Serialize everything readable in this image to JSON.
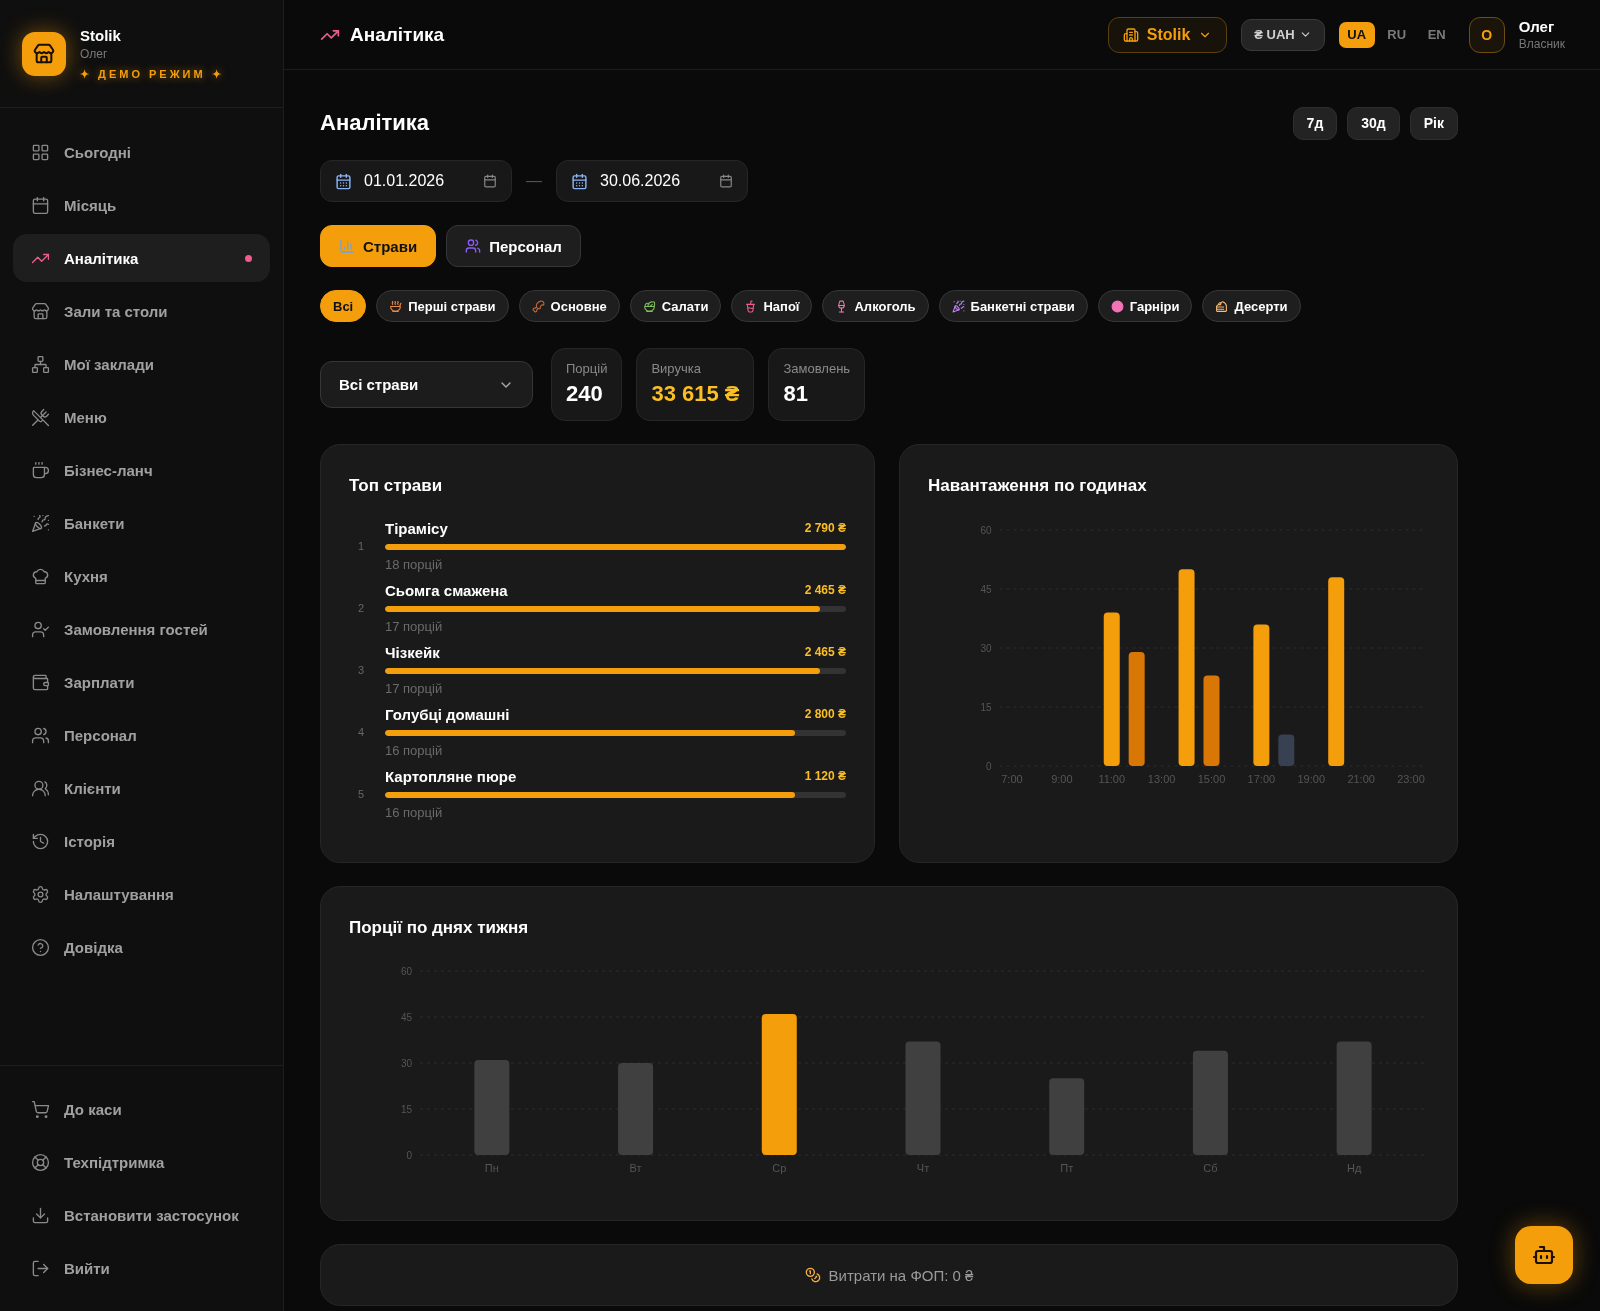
{
  "sidebar": {
    "brand": {
      "name": "Stolik",
      "user": "Олег",
      "mode_badge": "✦ ДЕМО РЕЖИМ ✦"
    },
    "nav": [
      {
        "label": "Сьогодні",
        "selected": false
      },
      {
        "label": "Місяць",
        "selected": false
      },
      {
        "label": "Аналітика",
        "selected": true
      },
      {
        "label": "Зали та столи",
        "selected": false
      },
      {
        "label": "Мої заклади",
        "selected": false
      },
      {
        "label": "Меню",
        "selected": false
      },
      {
        "label": "Бізнес-ланч",
        "selected": false
      },
      {
        "label": "Банкети",
        "selected": false
      },
      {
        "label": "Кухня",
        "selected": false
      },
      {
        "label": "Замовлення гостей",
        "selected": false
      },
      {
        "label": "Зарплати",
        "selected": false
      },
      {
        "label": "Персонал",
        "selected": false
      },
      {
        "label": "Клієнти",
        "selected": false
      },
      {
        "label": "Історія",
        "selected": false
      },
      {
        "label": "Налаштування",
        "selected": false
      },
      {
        "label": "Довідка",
        "selected": false
      }
    ],
    "bottom_nav": [
      "До каси",
      "Техпідтримка",
      "Встановити застосунок",
      "Вийти"
    ]
  },
  "header": {
    "title": "Аналітика",
    "venue": "Stolik",
    "currency": "₴ UAH",
    "languages": [
      {
        "label": "UA",
        "selected": true
      },
      {
        "label": "RU",
        "selected": false
      },
      {
        "label": "EN",
        "selected": false
      }
    ],
    "user": {
      "initial": "О",
      "name": "Олег",
      "role": "Власник"
    }
  },
  "page_title": "Аналітика",
  "periods": [
    "7д",
    "30д",
    "Рік"
  ],
  "date_range": {
    "from": "01.01.2026",
    "separator": "—",
    "to": "30.06.2026"
  },
  "tabs": [
    {
      "label": "Страви",
      "selected": true
    },
    {
      "label": "Персонал",
      "selected": false
    }
  ],
  "categories": [
    {
      "label": "Всі",
      "selected": true
    },
    {
      "label": "Перші страви",
      "selected": false
    },
    {
      "label": "Основне",
      "selected": false
    },
    {
      "label": "Салати",
      "selected": false
    },
    {
      "label": "Напої",
      "selected": false
    },
    {
      "label": "Алкоголь",
      "selected": false
    },
    {
      "label": "Банкетні страви",
      "selected": false
    },
    {
      "label": "Гарніри",
      "selected": false
    },
    {
      "label": "Десерти",
      "selected": false
    }
  ],
  "dish_filter": "Всі страви",
  "stats": [
    {
      "label": "Порцій",
      "value": "240",
      "accent": false
    },
    {
      "label": "Виручка",
      "value": "33 615 ₴",
      "accent": true
    },
    {
      "label": "Замовлень",
      "value": "81",
      "accent": false
    }
  ],
  "top_dishes": {
    "title": "Топ страви",
    "items": [
      {
        "rank": "1",
        "name": "Тірамісу",
        "amount": "2 790 ₴",
        "level": 1,
        "portions": "18 порцій"
      },
      {
        "rank": "2",
        "name": "Сьомга смажена",
        "amount": "2 465 ₴",
        "level": 0.944,
        "portions": "17 порцій"
      },
      {
        "rank": "3",
        "name": "Чізкейк",
        "amount": "2 465 ₴",
        "level": 0.944,
        "portions": "17 порцій"
      },
      {
        "rank": "4",
        "name": "Голубці домашні",
        "amount": "2 800 ₴",
        "level": 0.889,
        "portions": "16 порцій"
      },
      {
        "rank": "5",
        "name": "Картопляне пюре",
        "amount": "1 120 ₴",
        "level": 0.889,
        "portions": "16 порцій"
      }
    ]
  },
  "hourly_load": {
    "title": "Навантаження по годинах",
    "chart_data": {
      "type": "bar",
      "x": [
        11,
        12,
        14,
        15,
        17,
        18,
        20
      ],
      "values": [
        39,
        29,
        50,
        23,
        36,
        8,
        48
      ],
      "grid": true,
      "xlim": [
        6.5,
        23.5
      ],
      "ylim": [
        0,
        60
      ],
      "xticks": [
        {
          "value": 7,
          "label": "7:00"
        },
        {
          "value": 9,
          "label": "9:00"
        },
        {
          "value": 11,
          "label": "11:00"
        },
        {
          "value": 13,
          "label": "13:00"
        },
        {
          "value": 15,
          "label": "15:00"
        },
        {
          "value": 17,
          "label": "17:00"
        },
        {
          "value": 19,
          "label": "19:00"
        },
        {
          "value": 21,
          "label": "21:00"
        },
        {
          "value": 23,
          "label": "23:00"
        }
      ],
      "yticks": [
        0,
        15,
        30,
        45,
        60
      ]
    }
  },
  "weekday_portions": {
    "title": "Порції по днях тижня",
    "chart_data": {
      "type": "bar",
      "categories": [
        "Пн",
        "Вт",
        "Ср",
        "Чт",
        "Пт",
        "Сб",
        "Нд"
      ],
      "values": [
        31,
        30,
        46,
        37,
        25,
        34,
        37
      ],
      "grid": true,
      "ylim": [
        0,
        60
      ],
      "yticks": [
        0,
        15,
        30,
        45,
        60
      ]
    }
  },
  "fop_expenses": "Витрати на ФОП: 0 ₴"
}
